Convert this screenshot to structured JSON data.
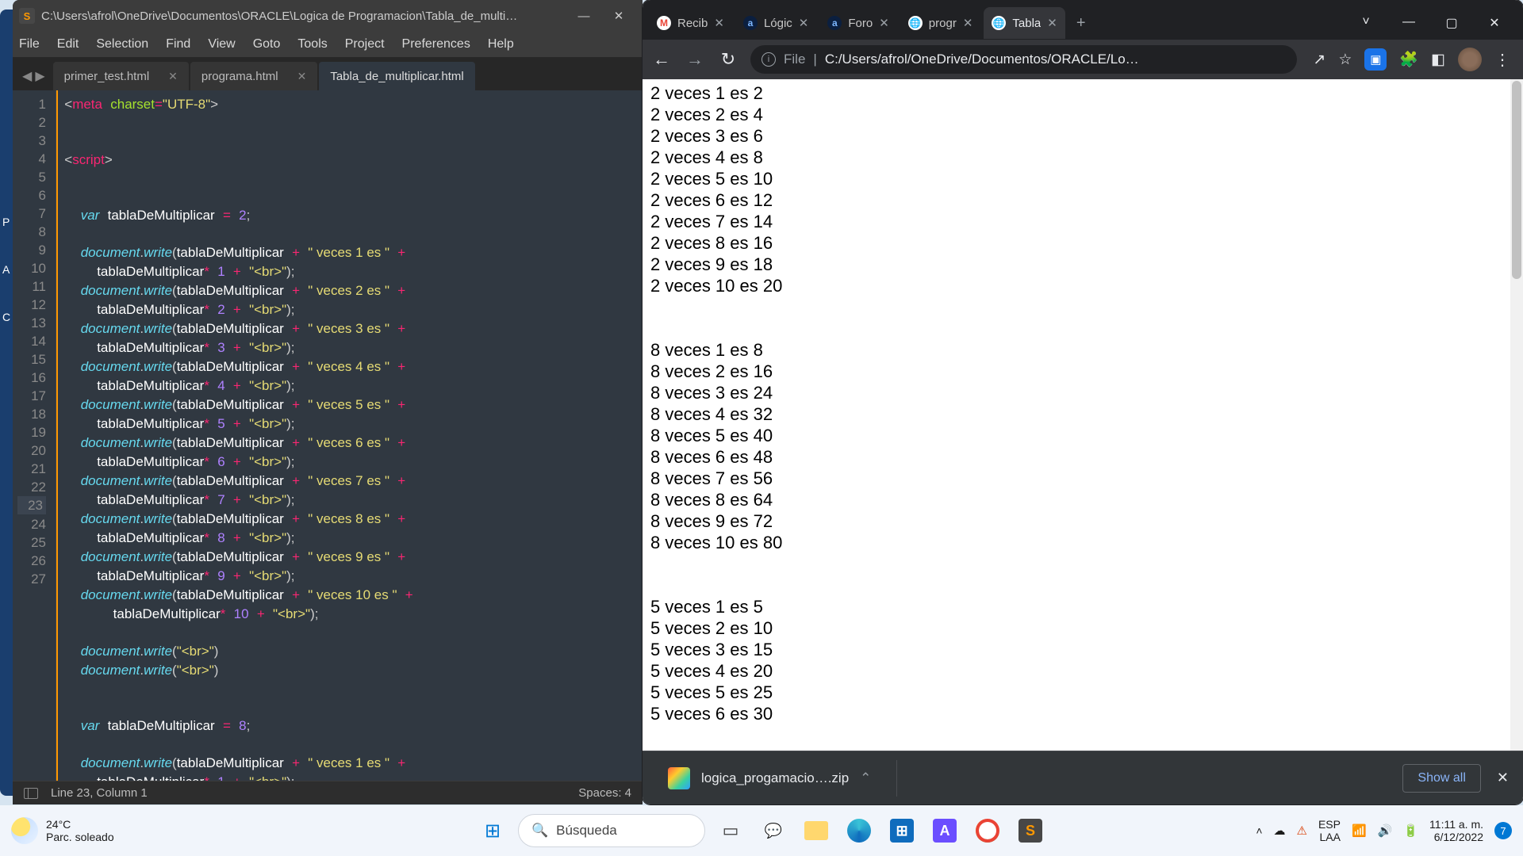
{
  "sublime": {
    "title": "C:\\Users\\afrol\\OneDrive\\Documentos\\ORACLE\\Logica de Programacion\\Tabla_de_multi…",
    "menu": [
      "File",
      "Edit",
      "Selection",
      "Find",
      "View",
      "Goto",
      "Tools",
      "Project",
      "Preferences",
      "Help"
    ],
    "tabs": [
      {
        "label": "primer_test.html",
        "active": false
      },
      {
        "label": "programa.html",
        "active": false
      },
      {
        "label": "Tabla_de_multiplicar.html",
        "active": true
      }
    ],
    "winbuttons": {
      "min": "—",
      "close": "✕"
    },
    "status": {
      "pos": "Line 23, Column 1",
      "spaces": "Spaces: 4"
    },
    "line_numbers": [
      1,
      2,
      3,
      4,
      5,
      6,
      7,
      8,
      9,
      10,
      11,
      12,
      13,
      14,
      15,
      16,
      17,
      18,
      19,
      20,
      21,
      22,
      23,
      24,
      25,
      26,
      27
    ],
    "highlight_line": 23
  },
  "chrome": {
    "tabs": [
      {
        "label": "Recib",
        "favbg": "#fff",
        "favtxt": "M",
        "favcolor": "#ea4335"
      },
      {
        "label": "Lógic",
        "favbg": "#0b1f3f",
        "favtxt": "a",
        "favcolor": "#7db7ff"
      },
      {
        "label": "Foro",
        "favbg": "#0b1f3f",
        "favtxt": "a",
        "favcolor": "#7db7ff"
      },
      {
        "label": "progr",
        "favbg": "#fff",
        "favtxt": "🌐",
        "favcolor": "#5f6368"
      },
      {
        "label": "Tabla",
        "favbg": "#fff",
        "favtxt": "🌐",
        "favcolor": "#5f6368",
        "active": true
      }
    ],
    "winbuttons": {
      "caret": "˅",
      "min": "—",
      "max": "▢",
      "close": "✕"
    },
    "nav": {
      "back": "←",
      "forward": "→",
      "reload": "↻"
    },
    "omnibox": {
      "scheme": "File",
      "sep": "|",
      "path": "C:/Users/afrol/OneDrive/Documentos/ORACLE/Lo…"
    },
    "actions": {
      "share": "↗",
      "star": "☆",
      "meet": "▣",
      "ext": "🧩",
      "panel": "◧",
      "menu": "⋮"
    },
    "download": {
      "name": "logica_progamacio….zip",
      "chev": "⌃",
      "showall": "Show all",
      "close": "✕"
    },
    "page_lines": [
      "2 veces 1 es 2",
      "2 veces 2 es 4",
      "2 veces 3 es 6",
      "2 veces 4 es 8",
      "2 veces 5 es 10",
      "2 veces 6 es 12",
      "2 veces 7 es 14",
      "2 veces 8 es 16",
      "2 veces 9 es 18",
      "2 veces 10 es 20",
      "",
      "",
      "8 veces 1 es 8",
      "8 veces 2 es 16",
      "8 veces 3 es 24",
      "8 veces 4 es 32",
      "8 veces 5 es 40",
      "8 veces 6 es 48",
      "8 veces 7 es 56",
      "8 veces 8 es 64",
      "8 veces 9 es 72",
      "8 veces 10 es 80",
      "",
      "",
      "5 veces 1 es 5",
      "5 veces 2 es 10",
      "5 veces 3 es 15",
      "5 veces 4 es 20",
      "5 veces 5 es 25"
    ],
    "page_last": "5 veces 6 es 30"
  },
  "taskbar": {
    "weather": {
      "temp": "24°C",
      "desc": "Parc. soleado"
    },
    "search": "Búsqueda",
    "tray": {
      "lang1": "ESP",
      "lang2": "LAA",
      "time": "11:11 a. m.",
      "date": "6/12/2022",
      "notif": "7"
    }
  },
  "edge_chars": [
    "P",
    "A",
    "C"
  ]
}
